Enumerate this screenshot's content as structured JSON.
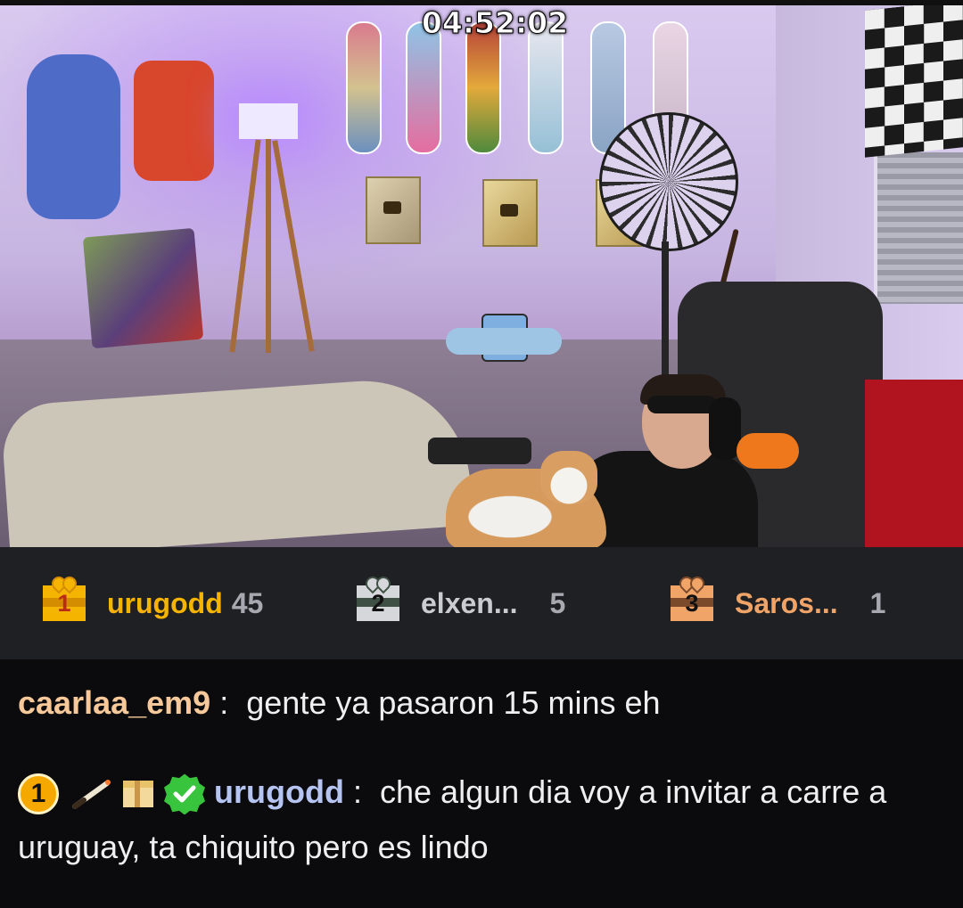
{
  "stream": {
    "timer": "04:52:02"
  },
  "leaderboard": [
    {
      "rank": "1",
      "name": "urugodd",
      "count": "45",
      "name_color": "#f5b400",
      "icon": "gift-rank-1-icon"
    },
    {
      "rank": "2",
      "name": "elxen...",
      "count": "5",
      "name_color": "#c9cdd2",
      "icon": "gift-rank-2-icon"
    },
    {
      "rank": "3",
      "name": "Saros...",
      "count": "1",
      "name_color": "#f0a467",
      "icon": "gift-rank-3-icon"
    }
  ],
  "chat": {
    "messages": [
      {
        "username": "caarlaa_em9",
        "separator": ":",
        "text": "gente ya pasaron 15 mins eh",
        "username_color": "#f7c99a"
      },
      {
        "badges": [
          {
            "name": "rank-one-badge-icon",
            "label": "1"
          },
          {
            "name": "joint-badge-icon"
          },
          {
            "name": "gift-badge-icon"
          },
          {
            "name": "verified-check-icon"
          }
        ],
        "username": "urugodd",
        "separator": ":",
        "text": "che algun dia voy a invitar a carre a uruguay, ta chiquito pero es lindo",
        "username_color": "#b6c4f2"
      }
    ]
  }
}
